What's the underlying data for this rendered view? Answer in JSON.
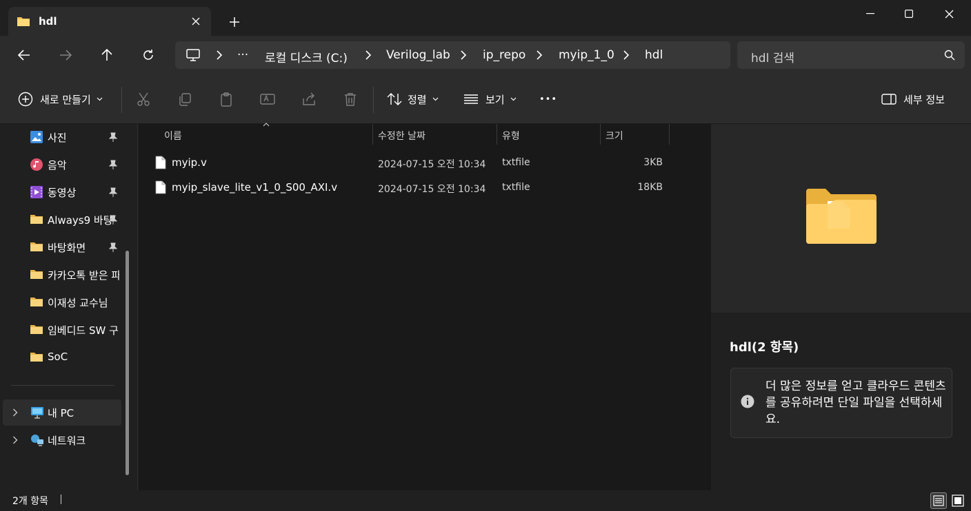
{
  "tab": {
    "title": "hdl",
    "close_label": "✕",
    "new_tab_label": "+"
  },
  "window": {
    "minimize": "—",
    "maximize": "☐",
    "close": "✕"
  },
  "nav": {
    "breadcrumbs": [
      "···",
      "로컬 디스크 (C:)",
      "Verilog_lab",
      "ip_repo",
      "myip_1_0",
      "hdl"
    ],
    "search_placeholder": "hdl 검색"
  },
  "toolbar": {
    "new_label": "새로 만들기",
    "sort_label": "정렬",
    "view_label": "보기",
    "more_label": "•••",
    "details_label": "세부 정보"
  },
  "sidebar": {
    "items": [
      {
        "label": "사진",
        "icon": "photos-icon",
        "pinned": true
      },
      {
        "label": "음악",
        "icon": "music-icon",
        "pinned": true
      },
      {
        "label": "동영상",
        "icon": "video-icon",
        "pinned": true
      },
      {
        "label": "Always9 바탕",
        "icon": "folder-icon",
        "pinned": true
      },
      {
        "label": "바탕화면",
        "icon": "folder-icon",
        "pinned": true
      },
      {
        "label": "카카오톡 받은 파",
        "icon": "folder-icon",
        "pinned": false
      },
      {
        "label": "이재성 교수님",
        "icon": "folder-icon",
        "pinned": false
      },
      {
        "label": "임베디드 SW 구",
        "icon": "folder-icon",
        "pinned": false
      },
      {
        "label": "SoC",
        "icon": "folder-icon",
        "pinned": false
      }
    ],
    "pc_label": "내 PC",
    "network_label": "네트워크"
  },
  "columns": {
    "name": "이름",
    "date": "수정한 날짜",
    "type": "유형",
    "size": "크기"
  },
  "files": [
    {
      "name": "myip.v",
      "date": "2024-07-15 오전 10:34",
      "type": "txtfile",
      "size": "3KB"
    },
    {
      "name": "myip_slave_lite_v1_0_S00_AXI.v",
      "date": "2024-07-15 오전 10:34",
      "type": "txtfile",
      "size": "18KB"
    }
  ],
  "details": {
    "title": "hdl(2 항목)",
    "info": "더 많은 정보를 얻고 클라우드 콘텐츠를 공유하려면 단일 파일을 선택하세요."
  },
  "status": {
    "count": "2개 항목"
  },
  "colors": {
    "accent": "#60cdff",
    "folder": "#f2c55c"
  }
}
